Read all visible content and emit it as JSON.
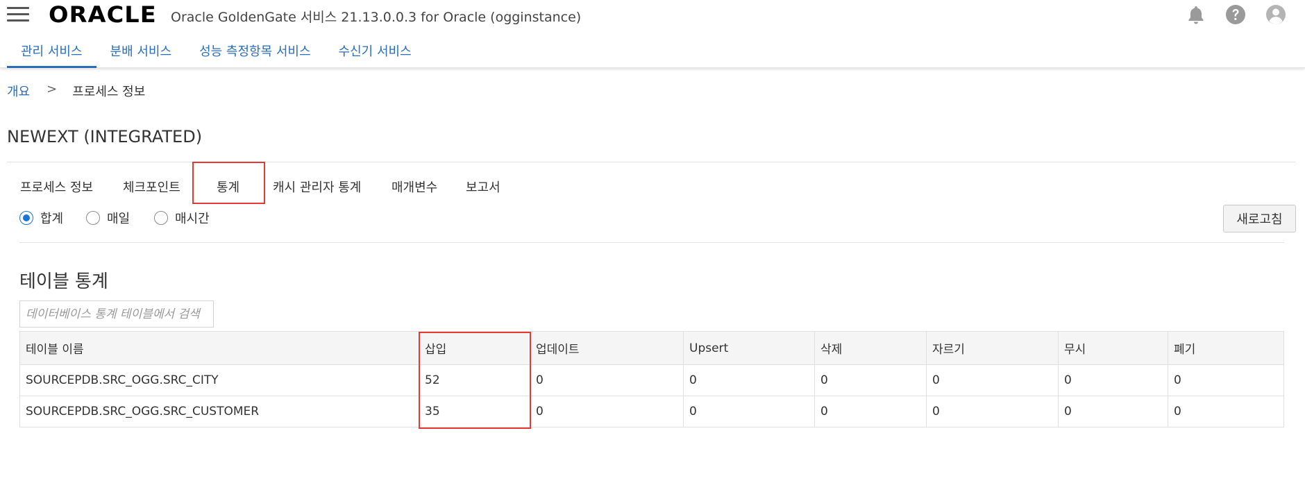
{
  "header": {
    "logo": "ORACLE",
    "title": "Oracle GoldenGate 서비스 21.13.0.0.3 for Oracle (ogginstance)"
  },
  "nav": {
    "tabs": [
      {
        "label": "관리 서비스",
        "active": true
      },
      {
        "label": "분배 서비스",
        "active": false
      },
      {
        "label": "성능 측정항목 서비스",
        "active": false
      },
      {
        "label": "수신기 서비스",
        "active": false
      }
    ]
  },
  "breadcrumb": {
    "home": "개요",
    "separator": ">",
    "current": "프로세스 정보"
  },
  "page_title": "NEWEXT (INTEGRATED)",
  "subtabs": [
    "프로세스 정보",
    "체크포인트",
    "통계",
    "캐시 관리자 통계",
    "매개변수",
    "보고서"
  ],
  "active_subtab": "통계",
  "radios": [
    {
      "label": "합계",
      "checked": true
    },
    {
      "label": "매일",
      "checked": false
    },
    {
      "label": "매시간",
      "checked": false
    }
  ],
  "refresh_label": "새로고침",
  "section_title": "테이블 통계",
  "search": {
    "placeholder": "데이터베이스 통계 테이블에서 검색",
    "value": ""
  },
  "table": {
    "columns": [
      "테이블 이름",
      "삽입",
      "업데이트",
      "Upsert",
      "삭제",
      "자르기",
      "무시",
      "폐기"
    ],
    "rows": [
      [
        "SOURCEPDB.SRC_OGG.SRC_CITY",
        "52",
        "0",
        "0",
        "0",
        "0",
        "0",
        "0"
      ],
      [
        "SOURCEPDB.SRC_OGG.SRC_CUSTOMER",
        "35",
        "0",
        "0",
        "0",
        "0",
        "0",
        "0"
      ]
    ]
  },
  "colors": {
    "accent": "#2a6ebb",
    "highlight": "#e53935",
    "radio": "#1a73d8",
    "icon": "#9a9a9a"
  }
}
